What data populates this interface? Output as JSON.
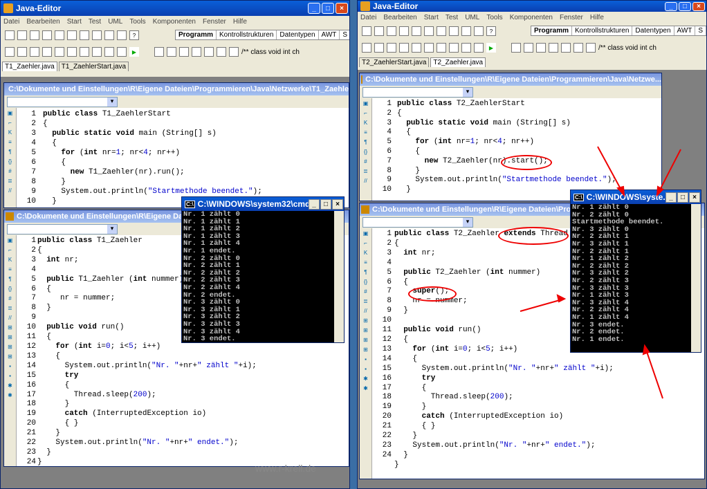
{
  "left": {
    "title": "Java-Editor",
    "menu": [
      "Datei",
      "Bearbeiten",
      "Start",
      "Test",
      "UML",
      "Tools",
      "Komponenten",
      "Fenster",
      "Hilfe"
    ],
    "palette_tabs": [
      "Programm",
      "Kontrollstrukturen",
      "Datentypen",
      "AWT",
      "S"
    ],
    "palette_snippet": "/** class void int ch",
    "file_tabs": [
      "T1_Zaehler.java",
      "T1_ZaehlerStart.java"
    ],
    "sub1_title": "C:\\Dokumente und Einstellungen\\R\\Eigene Dateien\\Programmieren\\Java\\Netzwerke\\T1_Zaehler",
    "sub2_title": "C:\\Dokumente und Einstellungen\\R\\Eigene Dateien\\Progr"
  },
  "right": {
    "title": "Java-Editor",
    "menu": [
      "Datei",
      "Bearbeiten",
      "Start",
      "Test",
      "UML",
      "Tools",
      "Komponenten",
      "Fenster",
      "Hilfe"
    ],
    "palette_tabs": [
      "Programm",
      "Kontrollstrukturen",
      "Datentypen",
      "AWT",
      "S"
    ],
    "palette_snippet": "/** class void int ch",
    "file_tabs": [
      "T2_ZaehlerStart.java",
      "T2_Zaehler.java"
    ],
    "sub1_title": "C:\\Dokumente und Einstellungen\\R\\Eigene Dateien\\Programmieren\\Java\\Netzwe...",
    "sub2_title": "C:\\Dokumente und Einstellungen\\R\\Eigene Dateien\\Progr"
  },
  "cmd1": {
    "title": "C:\\WINDOWS\\system32\\cmd.exe",
    "output": "Nr. 1 zählt 0\nNr. 1 zählt 1\nNr. 1 zählt 2\nNr. 1 zählt 3\nNr. 1 zählt 4\nNr. 1 endet.\nNr. 2 zählt 0\nNr. 2 zählt 1\nNr. 2 zählt 2\nNr. 2 zählt 3\nNr. 2 zählt 4\nNr. 2 endet.\nNr. 3 zählt 0\nNr. 3 zählt 1\nNr. 3 zählt 2\nNr. 3 zählt 3\nNr. 3 zählt 4\nNr. 3 endet.\nStartmethode beendet."
  },
  "cmd2": {
    "title": "C:\\WINDOWS\\syste...",
    "output": "Nr. 1 zählt 0\nNr. 2 zählt 0\nStartmethode beendet.\nNr. 3 zählt 0\nNr. 2 zählt 1\nNr. 3 zählt 1\nNr. 2 zählt 1\nNr. 1 zählt 2\nNr. 2 zählt 2\nNr. 3 zählt 2\nNr. 2 zählt 3\nNr. 3 zählt 3\nNr. 1 zählt 3\nNr. 3 zählt 4\nNr. 2 zählt 4\nNr. 1 zählt 4\nNr. 3 endet.\nNr. 2 endet.\nNr. 1 endet."
  },
  "watermark": "www.r-krell.de",
  "colors": {
    "titlebar": "#0a4fd0",
    "annotation": "#e00000"
  }
}
